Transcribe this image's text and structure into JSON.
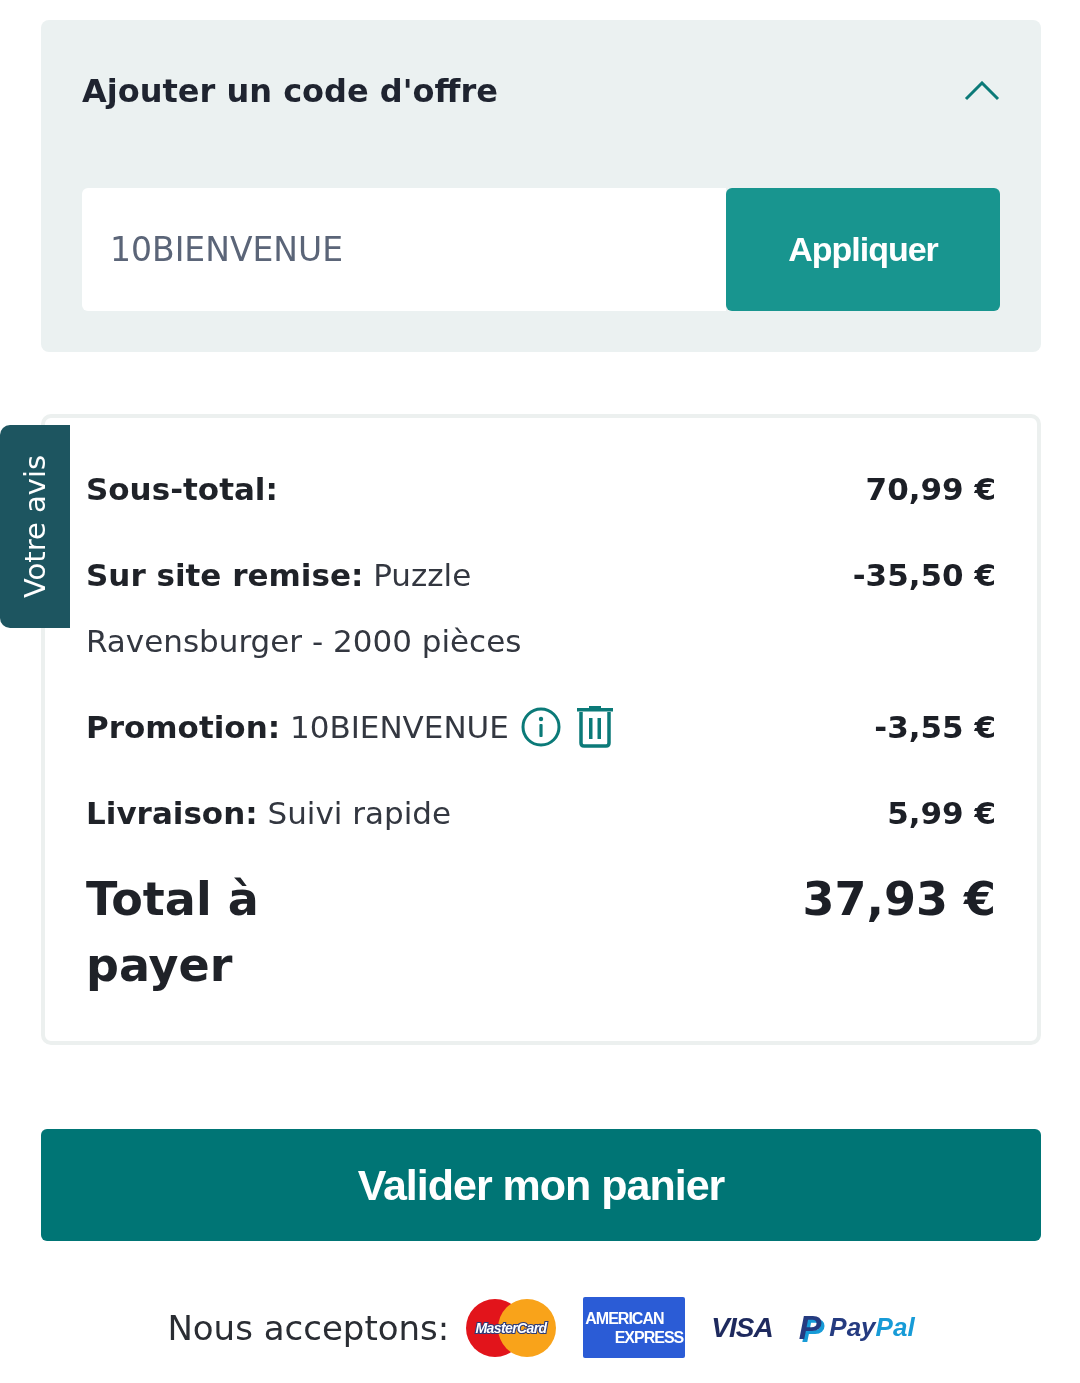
{
  "offer_code": {
    "title": "Ajouter un code d'offre",
    "expanded": true,
    "input": {
      "value": "10BIENVENUE"
    },
    "apply_button": "Appliquer"
  },
  "summary": {
    "rows": [
      {
        "kind": "line",
        "label": "Sous-total:",
        "value": "70,99 €"
      },
      {
        "kind": "line",
        "label": "Sur site remise:",
        "detail": "Puzzle Ravensburger - 2000 pièces",
        "value": "-35,50 €"
      },
      {
        "kind": "promo",
        "label": "Promotion:",
        "detail": "10BIENVENUE",
        "value": "-3,55 €"
      },
      {
        "kind": "line",
        "label": "Livraison:",
        "detail": "Suivi rapide",
        "value": "5,99 €"
      },
      {
        "kind": "total",
        "label": "Total à payer",
        "value": "37,93 €"
      }
    ]
  },
  "checkout_button": "Valider mon panier",
  "payment": {
    "label": "Nous acceptons:",
    "logos": [
      {
        "kind": "mastercard",
        "text": "MasterCard"
      },
      {
        "kind": "amex",
        "lines": [
          "AMERICAN",
          "EXPRESS"
        ]
      },
      {
        "kind": "visa",
        "text": "VISA"
      },
      {
        "kind": "paypal",
        "mark": "P",
        "parts": [
          "Pay",
          "Pal"
        ]
      }
    ]
  },
  "feedback_tab": "Votre avis"
}
